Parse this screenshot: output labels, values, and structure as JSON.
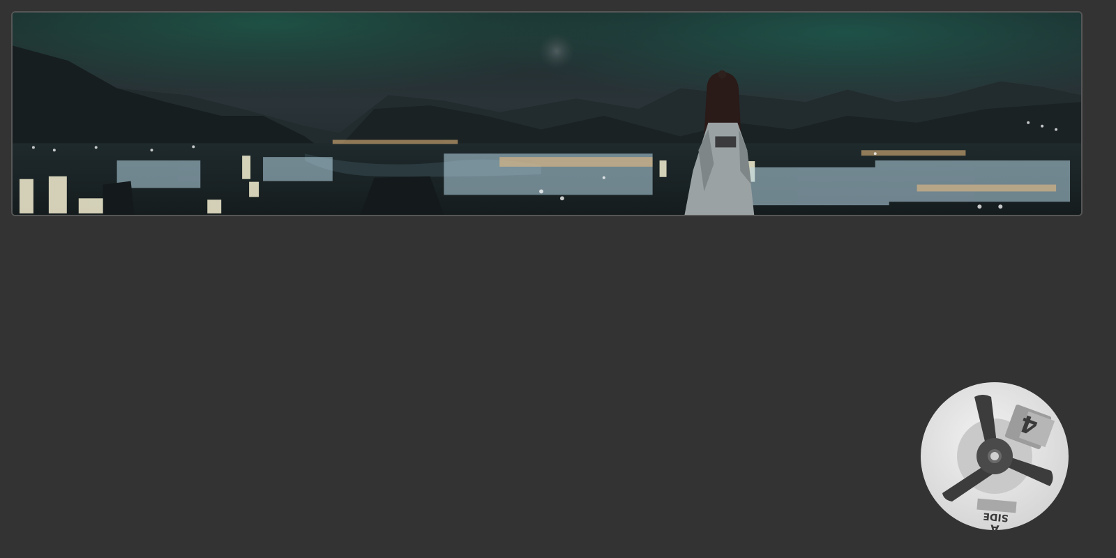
{
  "banner": {
    "scene": "night-city-landscape",
    "alt": ""
  },
  "player": {
    "disc_icon": "reel-to-reel-disc-icon",
    "track_number": "4",
    "side_word": "SIDE",
    "side_letter": "A",
    "colors": {
      "disc": "#e6e6e6",
      "inner_ring": "#c8c8c8",
      "spokes": "#3c3c3c",
      "hub": "#4a4a4a"
    }
  },
  "colors": {
    "background": "#333333",
    "banner_border": "#565656"
  }
}
